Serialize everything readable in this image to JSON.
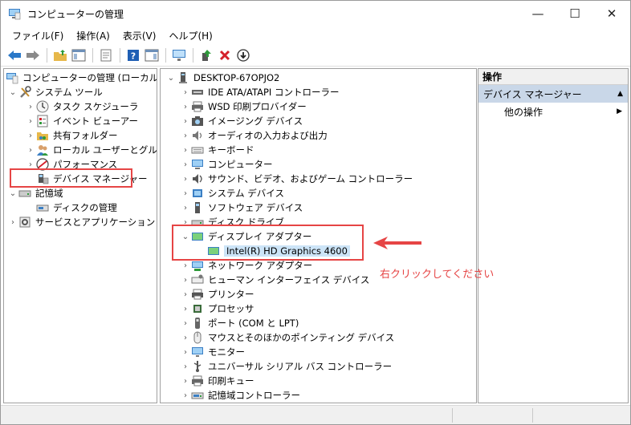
{
  "window": {
    "title": "コンピューターの管理",
    "controls": {
      "minimize": "—",
      "maximize": "☐",
      "close": "✕"
    }
  },
  "menu": [
    "ファイル(F)",
    "操作(A)",
    "表示(V)",
    "ヘルプ(H)"
  ],
  "left_tree": {
    "root": "コンピューターの管理 (ローカル)",
    "items": [
      "システム ツール",
      "タスク スケジューラ",
      "イベント ビューアー",
      "共有フォルダー",
      "ローカル ユーザーとグループ",
      "パフォーマンス",
      "デバイス マネージャー",
      "記憶域",
      "ディスクの管理",
      "サービスとアプリケーション"
    ]
  },
  "device_tree": {
    "root": "DESKTOP-67OPJO2",
    "categories": [
      "IDE ATA/ATAPI コントローラー",
      "WSD 印刷プロバイダー",
      "イメージング デバイス",
      "オーディオの入力および出力",
      "キーボード",
      "コンピューター",
      "サウンド、ビデオ、およびゲーム コントローラー",
      "システム デバイス",
      "ソフトウェア デバイス",
      "ディスク ドライブ",
      "ディスプレイ アダプター",
      "ネットワーク アダプター",
      "ヒューマン インターフェイス デバイス",
      "プリンター",
      "プロセッサ",
      "ポート (COM と LPT)",
      "マウスとそのほかのポインティング デバイス",
      "モニター",
      "ユニバーサル シリアル バス コントローラー",
      "印刷キュー",
      "記憶域コントローラー"
    ],
    "display_child": "Intel(R) HD Graphics 4600"
  },
  "actions": {
    "header": "操作",
    "selected": "デバイス マネージャー",
    "other": "他の操作"
  },
  "annotation": "右クリックしてください",
  "colors": {
    "accent_red": "#e64545",
    "selection": "#c9d7e8"
  }
}
